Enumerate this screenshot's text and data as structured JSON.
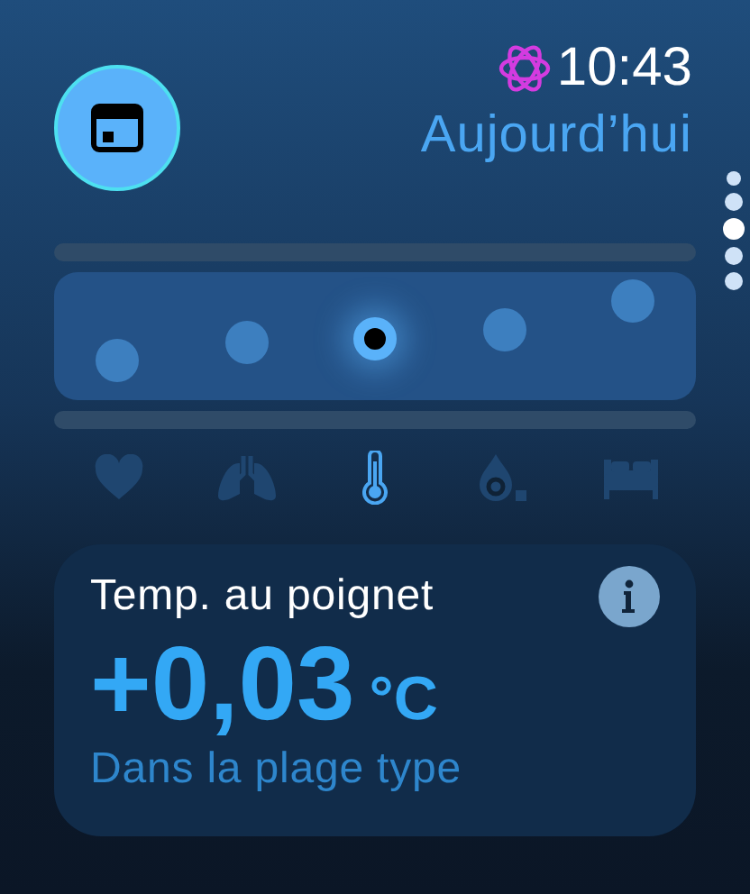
{
  "header": {
    "time": "10:43",
    "title": "Aujourd’hui"
  },
  "page_dots": [
    {
      "selected": false
    },
    {
      "selected": false
    },
    {
      "selected": true
    },
    {
      "selected": false
    },
    {
      "selected": false
    }
  ],
  "chart": {
    "points": [
      {
        "selected": false
      },
      {
        "selected": false
      },
      {
        "selected": true
      },
      {
        "selected": false
      },
      {
        "selected": false
      }
    ]
  },
  "metrics": [
    {
      "kind": "heart",
      "selected": false
    },
    {
      "kind": "lungs",
      "selected": false
    },
    {
      "kind": "thermometer",
      "selected": true
    },
    {
      "kind": "oxygen",
      "selected": false
    },
    {
      "kind": "sleep",
      "selected": false
    }
  ],
  "card": {
    "title": "Temp. au poignet",
    "value": "+0,03",
    "unit": "°C",
    "status": "Dans la plage type"
  }
}
